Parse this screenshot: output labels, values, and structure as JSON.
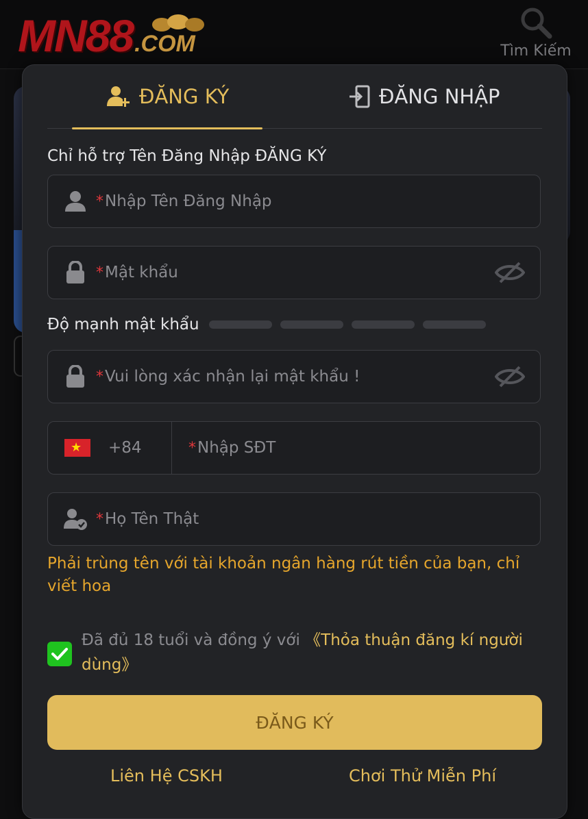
{
  "brand": {
    "logo_main": "MN88",
    "logo_suffix": ".COM"
  },
  "header": {
    "search_label": "Tìm Kiếm"
  },
  "tabs": {
    "register_label": "ĐĂNG KÝ",
    "login_label": "ĐĂNG NHẬP"
  },
  "form": {
    "hint": "Chỉ hỗ trợ Tên Đăng Nhập ĐĂNG KÝ",
    "required_mark": "*",
    "username_placeholder": "Nhập Tên Đăng Nhập",
    "password_placeholder": "Mật khẩu",
    "strength_label": "Độ mạnh mật khẩu",
    "strength_level": 0,
    "confirm_placeholder": "Vui lòng xác nhận lại mật khẩu !",
    "phone_code": "+84",
    "phone_placeholder": "Nhập SĐT",
    "realname_placeholder": "Họ Tên Thật",
    "realname_warning": "Phải trùng tên với tài khoản ngân hàng rút tiền của bạn, chỉ viết hoa",
    "agree_text": "Đã đủ 18 tuổi và đồng ý với ",
    "agree_link": "《Thỏa thuận đăng kí người dùng》",
    "agree_checked": true,
    "submit_label": "ĐĂNG KÝ"
  },
  "footer": {
    "contact_label": "Liên Hệ CSKH",
    "trial_label": "Chơi Thử Miễn Phí"
  },
  "colors": {
    "accent_gold": "#e4bd5b",
    "warning_orange": "#e6a62c",
    "check_green": "#1fc31f",
    "required_red": "#e0373b",
    "modal_bg": "#222326"
  }
}
